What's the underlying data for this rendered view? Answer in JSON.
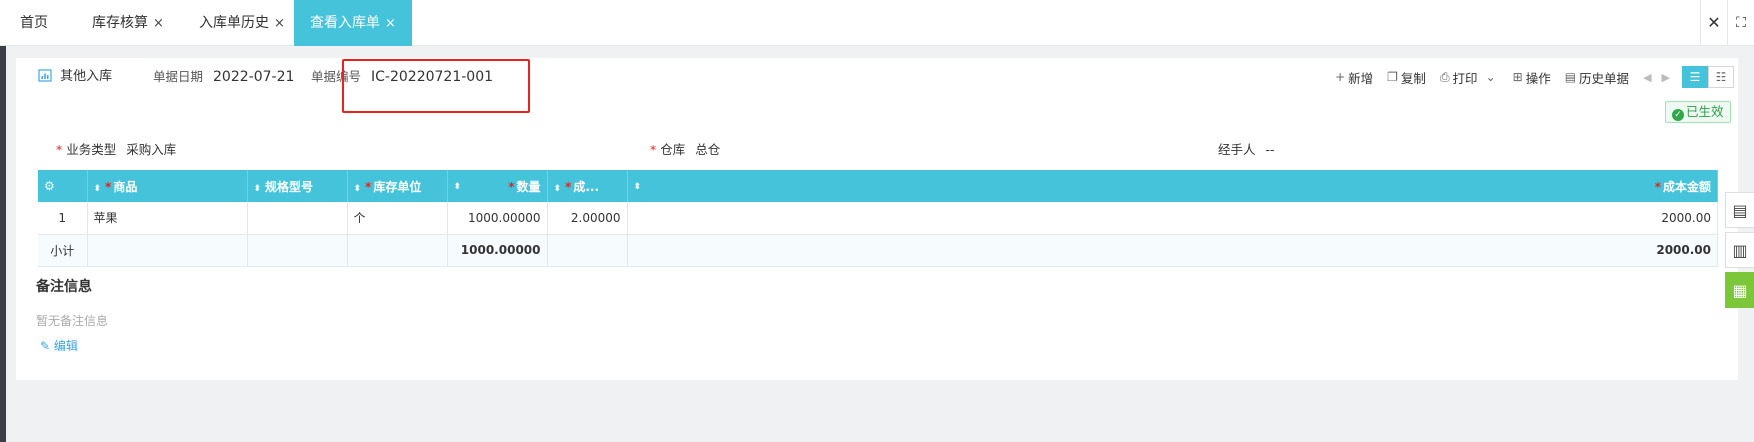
{
  "tabs": [
    {
      "label": "首页",
      "closable": false
    },
    {
      "label": "库存核算",
      "closable": true
    },
    {
      "label": "入库单历史",
      "closable": true
    },
    {
      "label": "查看入库单",
      "closable": true,
      "active": true
    }
  ],
  "tab_close_glyph": "×",
  "window": {
    "close_glyph": "✕",
    "fullscreen_glyph": "⛶"
  },
  "doc": {
    "type_tab": "其他入库",
    "date_label": "单据日期",
    "date": "2022-07-21",
    "number_label": "单据编号",
    "number": "IC-20220721-001",
    "status": "已生效"
  },
  "toolbar": {
    "add": "新增",
    "copy": "复制",
    "print": "打印",
    "operate": "操作",
    "history": "历史单据"
  },
  "fields": {
    "biz_type_label": "业务类型",
    "biz_type": "采购入库",
    "warehouse_label": "仓库",
    "warehouse": "总仓",
    "handler_label": "经手人",
    "handler": "--"
  },
  "table": {
    "columns": [
      "商品",
      "规格型号",
      "库存单位",
      "数量",
      "成...",
      "成本金额"
    ],
    "rows": [
      {
        "index": "1",
        "product": "苹果",
        "spec": "",
        "unit": "个",
        "qty": "1000.00000",
        "cost": "2.00000",
        "amount": "2000.00"
      }
    ],
    "subtotal": {
      "label": "小计",
      "qty": "1000.00000",
      "amount": "2000.00"
    }
  },
  "notes": {
    "title": "备注信息",
    "empty": "暂无备注信息",
    "edit": "编辑"
  },
  "colors": {
    "accent": "#44c3da",
    "highlight_box": "#e8231f",
    "status_green": "#2d9c4b",
    "side_green": "#7cc63a"
  }
}
